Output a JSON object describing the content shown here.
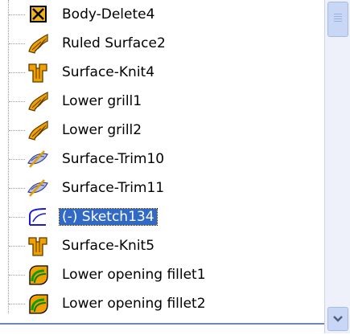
{
  "tree": {
    "items": [
      {
        "label": "Body-Delete4",
        "icon": "body-delete-icon",
        "selected": false
      },
      {
        "label": "Ruled Surface2",
        "icon": "ruled-surface-icon",
        "selected": false
      },
      {
        "label": "Surface-Knit4",
        "icon": "surface-knit-icon",
        "selected": false
      },
      {
        "label": "Lower grill1",
        "icon": "ruled-surface-icon",
        "selected": false
      },
      {
        "label": "Lower grill2",
        "icon": "ruled-surface-icon",
        "selected": false
      },
      {
        "label": "Surface-Trim10",
        "icon": "surface-trim-icon",
        "selected": false
      },
      {
        "label": "Surface-Trim11",
        "icon": "surface-trim-icon",
        "selected": false
      },
      {
        "label": "(-) Sketch134",
        "icon": "sketch-icon",
        "selected": true
      },
      {
        "label": "Surface-Knit5",
        "icon": "surface-knit-icon",
        "selected": false
      },
      {
        "label": "Lower opening fillet1",
        "icon": "fillet-icon",
        "selected": false
      },
      {
        "label": "Lower opening fillet2",
        "icon": "fillet-icon",
        "selected": false
      }
    ]
  },
  "colors": {
    "selection": "#3169c6",
    "icon_orange": "#f0a000",
    "scrollbar": "#eef1f9"
  }
}
